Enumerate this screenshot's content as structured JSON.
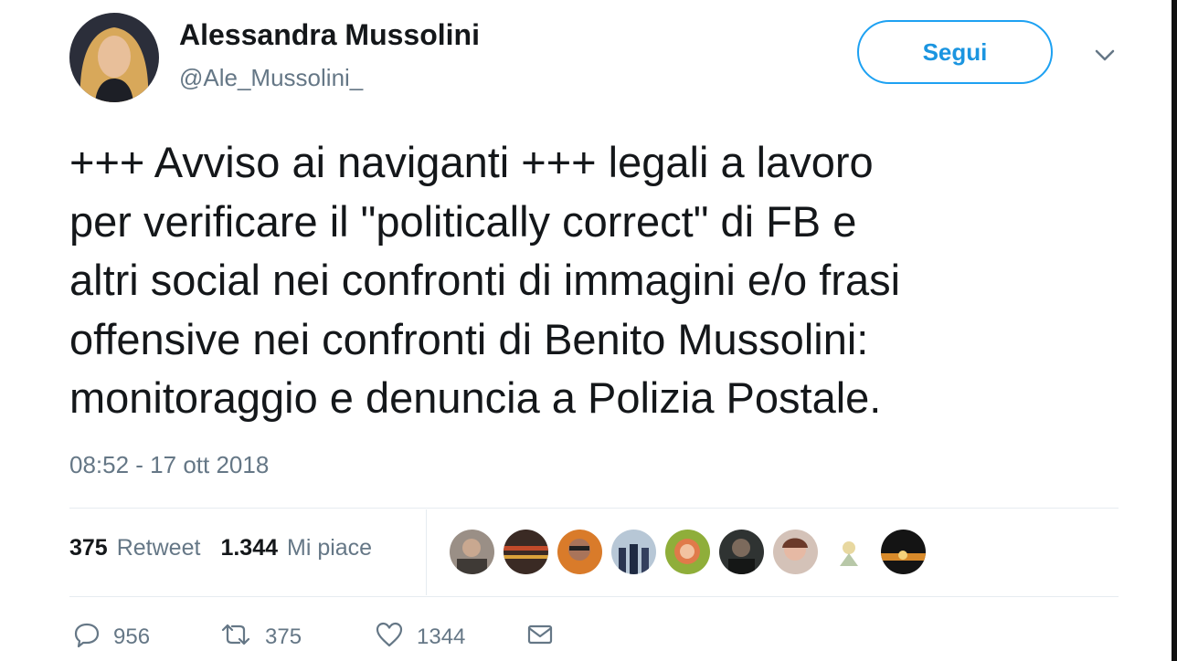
{
  "profile": {
    "name": "Alessandra Mussolini",
    "handle": "@Ale_Mussolini_"
  },
  "follow_label": "Segui",
  "tweet": {
    "lines": [
      "+++ Avviso ai naviganti +++ legali a lavoro",
      "per verificare il \"politically correct\" di FB e",
      "altri social nei confronti di immagini e/o frasi",
      "offensive nei confronti di Benito Mussolini:",
      "monitoraggio e denuncia a Polizia Postale."
    ],
    "timestamp": "08:52 - 17 ott 2018"
  },
  "stats": {
    "retweets": "375",
    "retweets_label": "Retweet",
    "likes": "1.344",
    "likes_label": "Mi piace"
  },
  "actions": {
    "replies": "956",
    "retweets": "375",
    "likes": "1344"
  },
  "colors": {
    "accent": "#1da1f2",
    "text": "#14171a",
    "secondary": "#657786"
  },
  "icons": [
    "chevron-down-icon",
    "reply-icon",
    "retweet-icon",
    "like-icon",
    "message-icon"
  ]
}
